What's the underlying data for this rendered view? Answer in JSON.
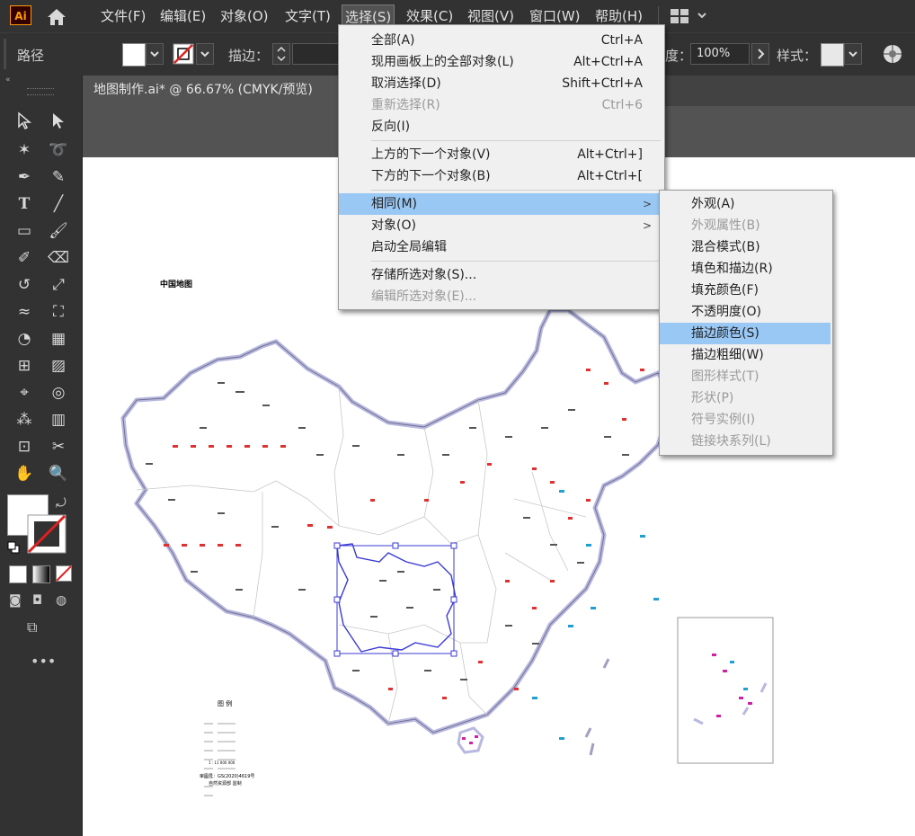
{
  "menubar": {
    "app_icon": "Ai",
    "items": [
      "文件(F)",
      "编辑(E)",
      "对象(O)",
      "文字(T)",
      "选择(S)",
      "效果(C)",
      "视图(V)",
      "窗口(W)",
      "帮助(H)"
    ]
  },
  "controlbar": {
    "object_type": "路径",
    "stroke_label": "描边：",
    "opacity_label": "度：",
    "opacity_value": "100%",
    "style_label": "样式："
  },
  "document": {
    "tab_title": "地图制作.ai* @ 66.67% (CMYK/预览)"
  },
  "map": {
    "title": "中国地图",
    "legend_title": "图   例",
    "legend_scale": "1 : 11 000 000",
    "approval_no": "审图号：GS(2020)4619号",
    "publisher": "自然资源部  监制"
  },
  "select_menu": {
    "items": [
      {
        "label": "全部(A)",
        "shortcut": "Ctrl+A",
        "disabled": false
      },
      {
        "label": "现用画板上的全部对象(L)",
        "shortcut": "Alt+Ctrl+A",
        "disabled": false
      },
      {
        "label": "取消选择(D)",
        "shortcut": "Shift+Ctrl+A",
        "disabled": false
      },
      {
        "label": "重新选择(R)",
        "shortcut": "Ctrl+6",
        "disabled": true
      },
      {
        "label": "反向(I)",
        "shortcut": "",
        "disabled": false
      },
      {
        "label": "上方的下一个对象(V)",
        "shortcut": "Alt+Ctrl+]",
        "disabled": false
      },
      {
        "label": "下方的下一个对象(B)",
        "shortcut": "Alt+Ctrl+[",
        "disabled": false
      },
      {
        "label": "相同(M)",
        "shortcut": "",
        "disabled": false
      },
      {
        "label": "对象(O)",
        "shortcut": "",
        "disabled": false
      },
      {
        "label": "启动全局编辑",
        "shortcut": "",
        "disabled": false
      },
      {
        "label": "存储所选对象(S)...",
        "shortcut": "",
        "disabled": false
      },
      {
        "label": "编辑所选对象(E)...",
        "shortcut": "",
        "disabled": true
      }
    ]
  },
  "same_submenu": {
    "items": [
      {
        "label": "外观(A)",
        "disabled": false
      },
      {
        "label": "外观属性(B)",
        "disabled": true
      },
      {
        "label": "混合模式(B)",
        "disabled": false
      },
      {
        "label": "填色和描边(R)",
        "disabled": false
      },
      {
        "label": "填充颜色(F)",
        "disabled": false
      },
      {
        "label": "不透明度(O)",
        "disabled": false
      },
      {
        "label": "描边颜色(S)",
        "disabled": false
      },
      {
        "label": "描边粗细(W)",
        "disabled": false
      },
      {
        "label": "图形样式(T)",
        "disabled": true
      },
      {
        "label": "形状(P)",
        "disabled": true
      },
      {
        "label": "符号实例(I)",
        "disabled": true
      },
      {
        "label": "链接块系列(L)",
        "disabled": true
      }
    ]
  },
  "colors": {
    "menu_highlight": "#99c8f5",
    "selection_blue": "#3a3ad6",
    "ui_dark": "#323232"
  }
}
